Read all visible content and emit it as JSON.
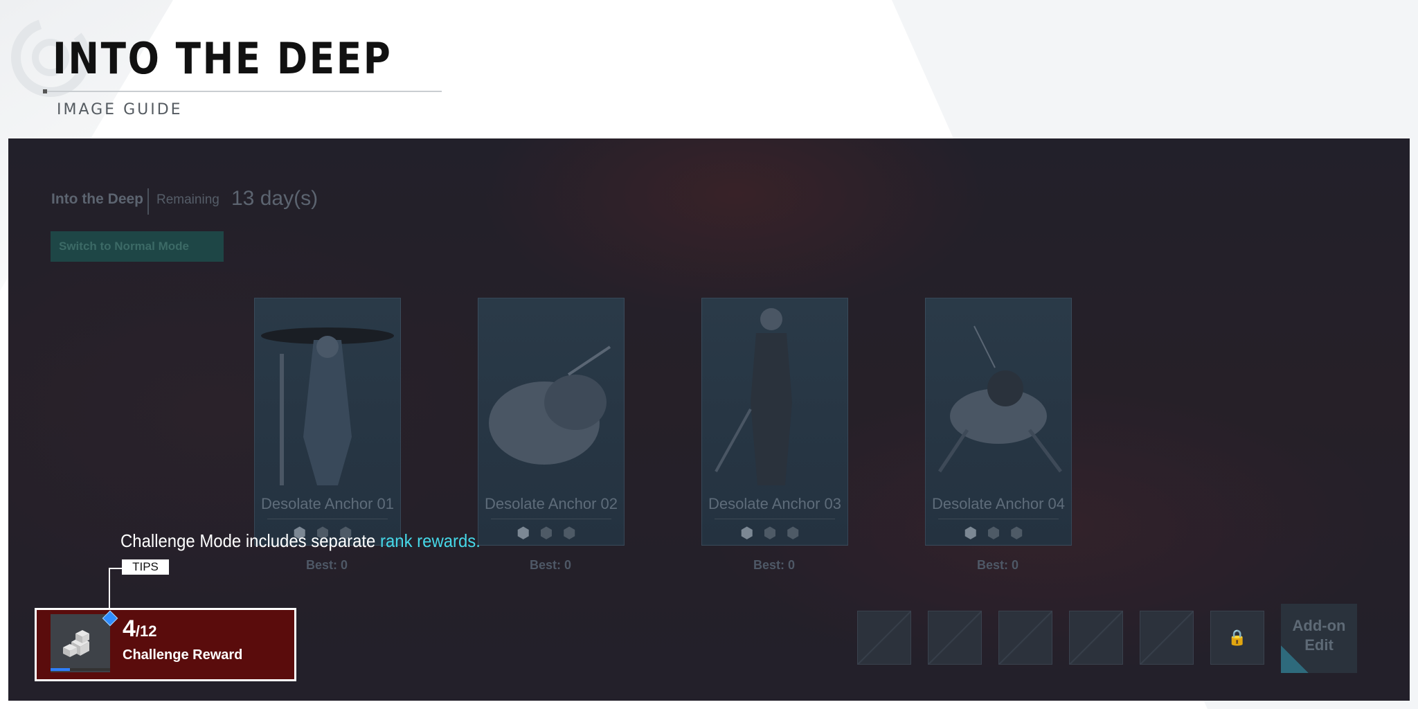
{
  "header": {
    "title": "INTO THE DEEP",
    "subtitle": "IMAGE GUIDE"
  },
  "game": {
    "mode_title": "Into the Deep",
    "remaining_label": "Remaining",
    "remaining_value": "13 day(s)",
    "switch_button": "Switch to Normal Mode",
    "stages": [
      {
        "name": "Desolate Anchor 01",
        "best": "Best: 0"
      },
      {
        "name": "Desolate Anchor 02",
        "best": "Best: 0"
      },
      {
        "name": "Desolate Anchor 03",
        "best": "Best: 0"
      },
      {
        "name": "Desolate Anchor 04",
        "best": "Best: 0"
      }
    ],
    "addon_button_line1": "Add-on",
    "addon_button_line2": "Edit"
  },
  "tip": {
    "text_prefix": "Challenge Mode includes separate ",
    "text_highlight": "rank rewards.",
    "tag": "TIPS"
  },
  "reward": {
    "current": "4",
    "total": "/12",
    "label": "Challenge Reward",
    "progress_fraction": 0.33
  },
  "colors": {
    "accent_cyan": "#46d8e8",
    "reward_bg": "#5a0c0c",
    "progress_blue": "#2f7fff"
  }
}
